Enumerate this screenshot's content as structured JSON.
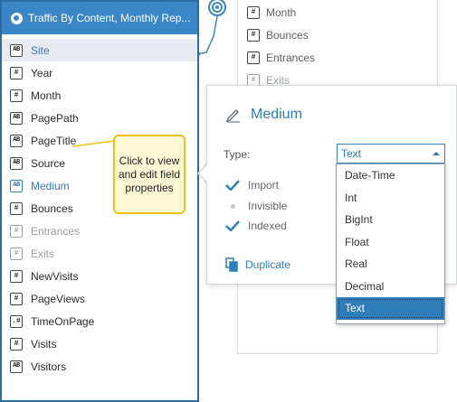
{
  "panel": {
    "title": "Traffic By Content, Monthly Rep...",
    "fields": [
      {
        "label": "Site",
        "icon": "AB",
        "state": "selected"
      },
      {
        "label": "Year",
        "icon": "#",
        "state": "normal"
      },
      {
        "label": "Month",
        "icon": "#",
        "state": "normal"
      },
      {
        "label": "PagePath",
        "icon": "AB",
        "state": "normal"
      },
      {
        "label": "PageTitle",
        "icon": "AB",
        "state": "normal"
      },
      {
        "label": "Source",
        "icon": "AB",
        "state": "normal"
      },
      {
        "label": "Medium",
        "icon": "AB",
        "state": "active"
      },
      {
        "label": "Bounces",
        "icon": "#",
        "state": "normal"
      },
      {
        "label": "Entrances",
        "icon": "#",
        "state": "disabled"
      },
      {
        "label": "Exits",
        "icon": "#",
        "state": "disabled"
      },
      {
        "label": "NewVisits",
        "icon": "#",
        "state": "normal"
      },
      {
        "label": "PageViews",
        "icon": "#",
        "state": "normal"
      },
      {
        "label": "TimeOnPage",
        "icon": ".#",
        "state": "normal"
      },
      {
        "label": "Visits",
        "icon": "#",
        "state": "normal"
      },
      {
        "label": "Visitors",
        "icon": "AB",
        "state": "normal"
      }
    ]
  },
  "background_fields": [
    {
      "label": "Month",
      "state": "normal"
    },
    {
      "label": "Bounces",
      "state": "normal"
    },
    {
      "label": "Entrances",
      "state": "normal"
    },
    {
      "label": "Exits",
      "state": "dim"
    }
  ],
  "tooltip": {
    "text": "Click to view and edit field properties"
  },
  "popup": {
    "title": "Medium",
    "type_label": "Type:",
    "type_value": "Text",
    "options": [
      {
        "label": "Import",
        "checked": true
      },
      {
        "label": "Invisible",
        "checked": false
      },
      {
        "label": "Indexed",
        "checked": true
      }
    ],
    "duplicate_label": "Duplicate"
  },
  "type_dropdown": {
    "options": [
      "Date-Time",
      "Int",
      "BigInt",
      "Float",
      "Real",
      "Decimal",
      "Text"
    ],
    "selected": "Text"
  },
  "colors": {
    "accent": "#3a87c8",
    "highlight": "#2f7ebc",
    "tooltip_border": "#f2c010",
    "tooltip_bg": "#fff9d6"
  }
}
